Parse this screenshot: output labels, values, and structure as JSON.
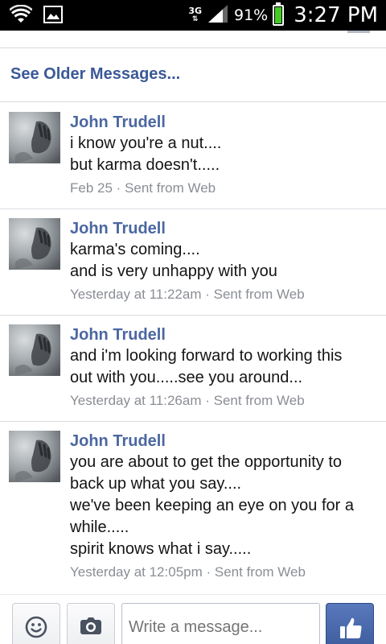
{
  "status_bar": {
    "network": "3G",
    "battery_percent": "91%",
    "battery_level": 0.91,
    "time": "3:27 PM",
    "icons": [
      "wifi-icon",
      "image-notification-icon",
      "signal-icon",
      "battery-icon"
    ]
  },
  "see_older": "See Older Messages...",
  "messages": [
    {
      "author": "John Trudell",
      "lines": [
        "i know you're a nut....",
        "but karma doesn't....."
      ],
      "meta": "Feb 25 · Sent from Web"
    },
    {
      "author": "John Trudell",
      "lines": [
        "karma's coming....",
        "and is very unhappy with you"
      ],
      "meta": "Yesterday at 11:22am · Sent from Web"
    },
    {
      "author": "John Trudell",
      "lines": [
        "and i'm looking forward to working this",
        "out with you.....see you around..."
      ],
      "meta": "Yesterday at 11:26am · Sent from Web"
    },
    {
      "author": "John Trudell",
      "lines": [
        "you are about to get the opportunity to",
        "back up what you say....",
        "we've been keeping an eye on you for a",
        "while.....",
        "spirit knows what i say....."
      ],
      "meta": "Yesterday at 12:05pm · Sent from Web"
    }
  ],
  "composer": {
    "placeholder": "Write a message...",
    "icons": [
      "emoji-icon",
      "camera-icon",
      "like-thumb-icon"
    ]
  },
  "colors": {
    "link": "#3b5998",
    "author": "#4b67a1",
    "meta": "#8a8e94",
    "battery": "#44cc22"
  }
}
